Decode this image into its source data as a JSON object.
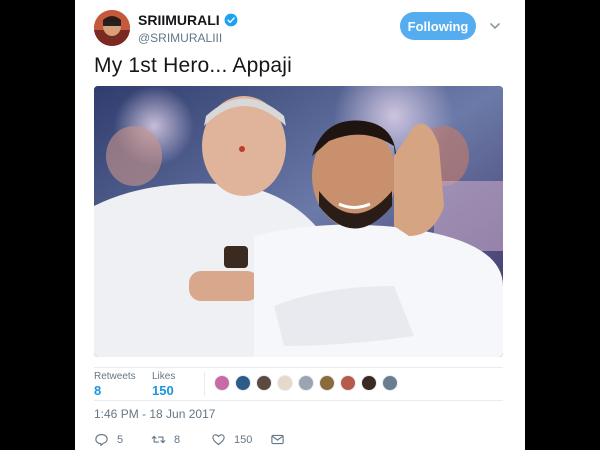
{
  "tweet": {
    "author": {
      "display_name": "SRIIMURALI",
      "handle": "@SRIMURALIII",
      "verified": true
    },
    "follow_button_label": "Following",
    "text": "My 1st Hero... Appaji",
    "stats": {
      "retweets_label": "Retweets",
      "retweets_count": "8",
      "likes_label": "Likes",
      "likes_count": "150"
    },
    "timestamp": "1:46 PM - 18 Jun 2017",
    "actions": {
      "reply_count": "5",
      "retweet_count": "8",
      "like_count": "150"
    }
  },
  "colors": {
    "accent": "#1b95e0",
    "follow_button": "#55acee",
    "secondary_text": "#657786",
    "background": "#000000"
  },
  "icons": [
    "verified-badge-icon",
    "chevron-down-icon",
    "reply-icon",
    "retweet-icon",
    "like-icon",
    "message-icon"
  ]
}
